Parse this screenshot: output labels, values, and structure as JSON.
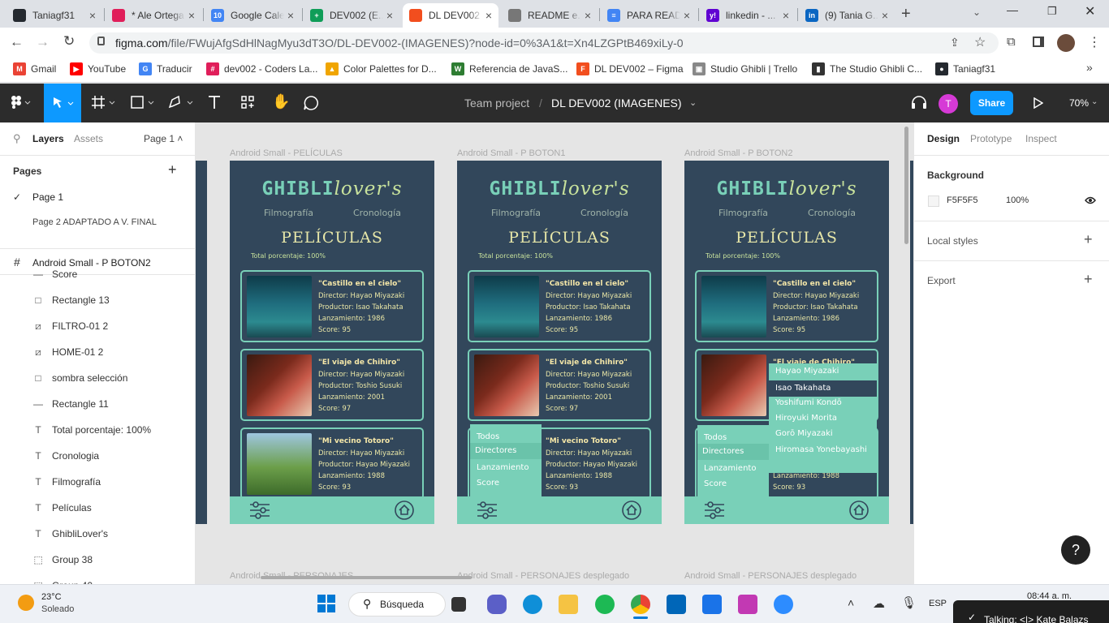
{
  "browser": {
    "tabs": [
      {
        "title": "Taniagf31",
        "icon": "github-icon",
        "color": "#24292f",
        "glyph": ""
      },
      {
        "title": "* Ale Ortega",
        "icon": "slack-icon",
        "color": "#e01e5a",
        "glyph": ""
      },
      {
        "title": "Google Calendar",
        "icon": "calendar-icon",
        "color": "#4285f4",
        "glyph": "10"
      },
      {
        "title": "DEV002 (E...",
        "icon": "sheets-icon",
        "color": "#0f9d58",
        "glyph": "+"
      },
      {
        "title": "DL DEV002",
        "icon": "figma-icon",
        "color": "#f24e1e",
        "glyph": ""
      },
      {
        "title": "README e...",
        "icon": "readme-icon",
        "color": "#777777",
        "glyph": ""
      },
      {
        "title": "PARA READ",
        "icon": "docs-icon",
        "color": "#4285f4",
        "glyph": "≡"
      },
      {
        "title": "linkedin - ...",
        "icon": "yahoo-icon",
        "color": "#6001d2",
        "glyph": "y!"
      },
      {
        "title": "(9) Tania G...",
        "icon": "linkedin-icon",
        "color": "#0a66c2",
        "glyph": "in"
      }
    ],
    "new_tab": "+",
    "url_main": "figma.com",
    "url_rest": "/file/FWujAfgSdHlNagMyu3dT3O/DL-DEV002-(IMAGENES)?node-id=0%3A1&t=Xn4LZGPtB469xiLy-0",
    "bookmarks": [
      {
        "label": "Gmail",
        "color": "#ea4335",
        "glyph": "M"
      },
      {
        "label": "YouTube",
        "color": "#ff0000",
        "glyph": "▶"
      },
      {
        "label": "Traducir",
        "color": "#4285f4",
        "glyph": "G"
      },
      {
        "label": "dev002 - Coders La...",
        "color": "#e01e5a",
        "glyph": "#"
      },
      {
        "label": "Color Palettes for D...",
        "color": "#f0a500",
        "glyph": "▲"
      },
      {
        "label": "Referencia de JavaS...",
        "color": "#2e7d32",
        "glyph": "W"
      },
      {
        "label": "DL DEV002 – Figma",
        "color": "#f24e1e",
        "glyph": "F"
      },
      {
        "label": "Studio Ghibli | Trello",
        "color": "#888888",
        "glyph": "▣"
      },
      {
        "label": "The Studio Ghibli C...",
        "color": "#333333",
        "glyph": "▮"
      },
      {
        "label": "Taniagf31",
        "color": "#24292f",
        "glyph": "●"
      }
    ],
    "bookmarks_more": "»"
  },
  "figma": {
    "breadcrumb_team": "Team project",
    "breadcrumb_sep": "/",
    "file_name": "DL DEV002 (IMAGENES)",
    "avatar_letter": "T",
    "share_label": "Share",
    "zoom": "70%",
    "accent": "#0d99ff",
    "avatar_color": "#d63ad6"
  },
  "left_panel": {
    "tab_layers": "Layers",
    "tab_assets": "Assets",
    "page_selector": "Page 1 ˄",
    "pages_title": "Pages",
    "add": "+",
    "pages": [
      "Page 1",
      "Page 2 ADAPTADO A V. FINAL"
    ],
    "frame_name": "Android Small - P BOTON2",
    "layers": [
      {
        "icon": "line-icon",
        "glyph": "—",
        "name": "Score"
      },
      {
        "icon": "rectangle-icon",
        "glyph": "□",
        "name": "Rectangle 13"
      },
      {
        "icon": "image-icon",
        "glyph": "⧄",
        "name": "FILTRO-01 2"
      },
      {
        "icon": "image-icon",
        "glyph": "⧄",
        "name": "HOME-01 2"
      },
      {
        "icon": "rectangle-icon",
        "glyph": "□",
        "name": "sombra selección"
      },
      {
        "icon": "line-icon",
        "glyph": "—",
        "name": "Rectangle 11"
      },
      {
        "icon": "text-icon",
        "glyph": "T",
        "name": "Total porcentaje: 100%"
      },
      {
        "icon": "text-icon",
        "glyph": "T",
        "name": "Cronologia"
      },
      {
        "icon": "text-icon",
        "glyph": "T",
        "name": "Filmografía"
      },
      {
        "icon": "text-icon",
        "glyph": "T",
        "name": "Películas"
      },
      {
        "icon": "text-icon",
        "glyph": "T",
        "name": "GhibliLover's"
      },
      {
        "icon": "group-icon",
        "glyph": "⬚",
        "name": "Group 38"
      },
      {
        "icon": "group-icon",
        "glyph": "⬚",
        "name": "Group 40"
      }
    ]
  },
  "canvas": {
    "frames": [
      {
        "label": "Android Small - PELÍCULAS",
        "variant": "plain"
      },
      {
        "label": "Android Small - P BOTON1",
        "variant": "menu"
      },
      {
        "label": "Android Small - P BOTON2",
        "variant": "dropdown"
      }
    ],
    "bottom_labels": [
      "Android Small - PERSONAJES",
      "Android Small - PERSONAJES desplegado",
      "Android Small - PERSONAJES desplegado"
    ],
    "app": {
      "logo_a": "GHIBLI",
      "logo_b": "lover's",
      "nav_film": "Filmografía",
      "nav_crono": "Cronología",
      "page_title": "PELÍCULAS",
      "total": "Total porcentaje: 100%",
      "cards": [
        {
          "title": "\"Castillo en el cielo\"",
          "director": "Director: Hayao Miyazaki",
          "producer": "Productor: Isao Takahata",
          "year": "Lanzamiento: 1986",
          "score": "Score: 95"
        },
        {
          "title": "\"El viaje de Chihiro\"",
          "director": "Director: Hayao Miyazaki",
          "producer": "Productor: Toshio Susuki",
          "year": "Lanzamiento: 2001",
          "score": "Score: 97"
        },
        {
          "title": "\"Mi vecino Totoro\"",
          "director": "Director: Hayao Miyazaki",
          "producer": "Productor: Hayao Miyazaki",
          "year": "Lanzamiento: 1988",
          "score": "Score: 93"
        }
      ],
      "filter_menu": [
        "Todos",
        "Directores",
        "Lanzamiento",
        "Score"
      ],
      "directors": [
        "Hayao Miyazaki",
        "Isao Takahata",
        "Yoshifumi Kondō",
        "Hiroyuki Morita",
        "Gorō Miyazaki",
        "Hiromasa Yonebayashi"
      ]
    }
  },
  "right_panel": {
    "tab_design": "Design",
    "tab_prototype": "Prototype",
    "tab_inspect": "Inspect",
    "background_title": "Background",
    "bg_hex": "F5F5F5",
    "bg_opacity": "100%",
    "bg_color": "#f5f5f5",
    "local_styles": "Local styles",
    "export": "Export",
    "add": "+",
    "help": "?"
  },
  "taskbar": {
    "temp": "23°C",
    "weather": "Soleado",
    "search": "Búsqueda",
    "lang": "ESP",
    "time": "08:44 a. m.",
    "notification": "Talking: <|> Kate Balazs"
  }
}
